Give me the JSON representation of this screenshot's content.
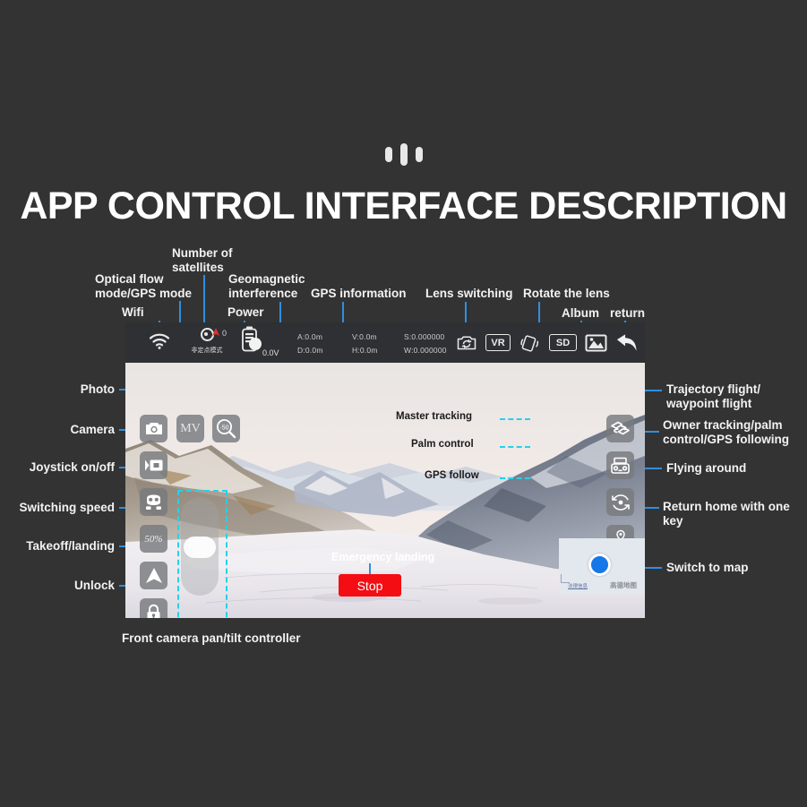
{
  "page": {
    "title": "APP CONTROL INTERFACE DESCRIPTION",
    "background_color": "#333333",
    "accent_color": "#2e8fe0",
    "cyan_color": "#24d2e8",
    "stop_color": "#f40d12"
  },
  "top_annotations": [
    {
      "name": "optical-flow-gps-mode",
      "line1": "Optical flow",
      "line2": "mode/GPS mode"
    },
    {
      "name": "number-of-satellites",
      "line1": "Number of",
      "line2": "satellites"
    },
    {
      "name": "wifi",
      "line1": "Wifi"
    },
    {
      "name": "power",
      "line1": "Power"
    },
    {
      "name": "geomagnetic-interference",
      "line1": "Geomagnetic",
      "line2": "interference"
    },
    {
      "name": "gps-information",
      "line1": "GPS information"
    },
    {
      "name": "lens-switching",
      "line1": "Lens switching"
    },
    {
      "name": "rotate-the-lens",
      "line1": "Rotate the lens"
    },
    {
      "name": "album",
      "line1": "Album"
    },
    {
      "name": "return",
      "line1": "return"
    }
  ],
  "statusbar": {
    "wifi_icon": "wifi-icon",
    "flow_mode_icon": "optical-flow-icon",
    "flow_mode_text": "非定点模式",
    "satellite_icon": "satellite-icon",
    "satellite_count": "0",
    "battery_icon": "battery-icon",
    "voltage": "0.0V",
    "telemetry": {
      "altitude": "A:0.0m",
      "distance": "D:0.0m",
      "vertical_speed": "V:0.0m",
      "horizontal_speed": "H:0.0m",
      "latitude": "S:0.000000",
      "longitude": "W:0.000000"
    },
    "buttons": [
      {
        "name": "lens-switch-icon",
        "label": ""
      },
      {
        "name": "vr-icon",
        "label": "VR"
      },
      {
        "name": "rotate-lens-icon",
        "label": ""
      },
      {
        "name": "sd-card-icon",
        "label": "SD"
      },
      {
        "name": "album-icon",
        "label": ""
      },
      {
        "name": "return-icon",
        "label": ""
      }
    ]
  },
  "left_controls": [
    {
      "name": "photo-button",
      "label": "Photo",
      "icon": "camera-icon",
      "text": ""
    },
    {
      "name": "camera-button",
      "label": "Camera",
      "icon": "video-camera-icon",
      "text": ""
    },
    {
      "name": "joystick-button",
      "label": "Joystick on/off",
      "icon": "gamepad-icon",
      "text": ""
    },
    {
      "name": "speed-button",
      "label": "Switching speed",
      "icon": "speed-text-icon",
      "text": "50%"
    },
    {
      "name": "takeoff-button",
      "label": "Takeoff/landing",
      "icon": "takeoff-arrow-icon",
      "text": ""
    },
    {
      "name": "unlock-button",
      "label": "Unlock",
      "icon": "lock-icon",
      "text": ""
    }
  ],
  "right_controls": [
    {
      "name": "trajectory-flight-button",
      "label_line1": "Trajectory flight/",
      "label_line2": "waypoint flight",
      "icon": "waypoint-icon"
    },
    {
      "name": "owner-tracking-button",
      "label_line1": "Owner tracking/palm",
      "label_line2": "control/GPS following",
      "icon": "remote-controller-icon"
    },
    {
      "name": "flying-around-button",
      "label_line1": "Flying around",
      "label_line2": "",
      "icon": "orbit-icon"
    },
    {
      "name": "return-home-button",
      "label_line1": "Return home with one",
      "label_line2": "key",
      "icon": "return-home-icon"
    }
  ],
  "overlay_buttons": {
    "mv": {
      "name": "mv-button",
      "text": "MV",
      "label": "MV"
    },
    "zoom": {
      "name": "zoom-button",
      "text": "50",
      "label": "50x zoom"
    }
  },
  "feed_labels": [
    {
      "name": "master-tracking-label",
      "text": "Master tracking"
    },
    {
      "name": "palm-control-label",
      "text": "Palm control"
    },
    {
      "name": "gps-follow-label",
      "text": "GPS follow"
    }
  ],
  "emergency": {
    "label": "Emergency landing",
    "button_text": "Stop"
  },
  "map_widget": {
    "name": "map-widget",
    "label": "Switch to map",
    "legal_text": "法律信息",
    "brand_text": "高德地图"
  },
  "bottom_caption": {
    "name": "pan-tilt-caption",
    "text": "Front camera pan/tilt controller"
  }
}
